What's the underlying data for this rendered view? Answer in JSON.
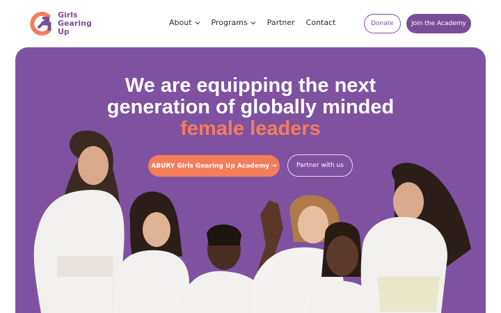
{
  "brand": {
    "name_line1": "Girls",
    "name_line2": "Gearing",
    "name_line3": "Up",
    "color_primary": "#7c4d97",
    "color_accent": "#f47d5b"
  },
  "nav": {
    "items": [
      {
        "label": "About",
        "has_dropdown": true
      },
      {
        "label": "Programs",
        "has_dropdown": true
      },
      {
        "label": "Partner",
        "has_dropdown": false
      },
      {
        "label": "Contact",
        "has_dropdown": false
      }
    ]
  },
  "header_actions": {
    "donate_label": "Donate",
    "join_label": "Join the Academy"
  },
  "hero": {
    "headline_line1": "We are equipping the next",
    "headline_line2": "generation of globally minded",
    "headline_accent": "female leaders",
    "cta_primary_label": "ABURY Girls Gearing Up Academy →",
    "cta_secondary_label": "Partner with us",
    "background_color": "#7e52a0",
    "photo_description_icon": "group-of-smiling-girls-photo"
  }
}
